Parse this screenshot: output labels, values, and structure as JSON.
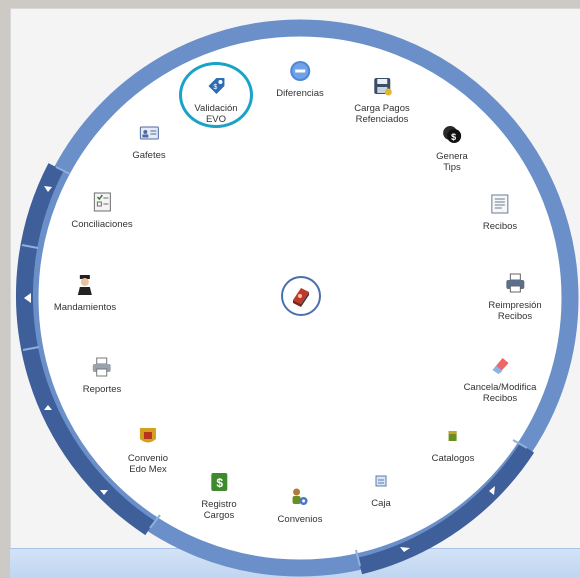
{
  "menu": {
    "items": [
      {
        "id": "validacion",
        "label": "Validación\nEVO",
        "icon": "tag-icon"
      },
      {
        "id": "diferencias",
        "label": "Diferencias",
        "icon": "minus-circle-icon"
      },
      {
        "id": "carga",
        "label": "Carga Pagos\nRefenciados",
        "icon": "save-disk-icon"
      },
      {
        "id": "genera",
        "label": "Genera\nTips",
        "icon": "money-icon"
      },
      {
        "id": "recibos",
        "label": "Recibos",
        "icon": "document-list-icon"
      },
      {
        "id": "reimpresion",
        "label": "Reimpresión\nRecibos",
        "icon": "printer-icon"
      },
      {
        "id": "cancela",
        "label": "Cancela/Modifica\nRecibos",
        "icon": "eraser-icon"
      },
      {
        "id": "catalogos",
        "label": "Catalogos",
        "icon": "catalog-icon"
      },
      {
        "id": "caja",
        "label": "Caja",
        "icon": "cash-register-icon"
      },
      {
        "id": "convenios",
        "label": "Convenios",
        "icon": "handshake-icon"
      },
      {
        "id": "registro",
        "label": "Registro\nCargos",
        "icon": "dollar-book-icon"
      },
      {
        "id": "convenio_edomex",
        "label": "Convenio\nEdo Mex",
        "icon": "shield-emblem-icon"
      },
      {
        "id": "reportes",
        "label": "Reportes",
        "icon": "printer-report-icon"
      },
      {
        "id": "mandamientos",
        "label": "Mandamientos",
        "icon": "person-icon"
      },
      {
        "id": "conciliaciones",
        "label": "Conciliaciones",
        "icon": "checklist-icon"
      },
      {
        "id": "gafetes",
        "label": "Gafetes",
        "icon": "id-card-icon"
      }
    ]
  },
  "colors": {
    "ring": "#5f86c4",
    "ring_dark": "#3e5f99",
    "highlight": "#1aa3c7"
  }
}
